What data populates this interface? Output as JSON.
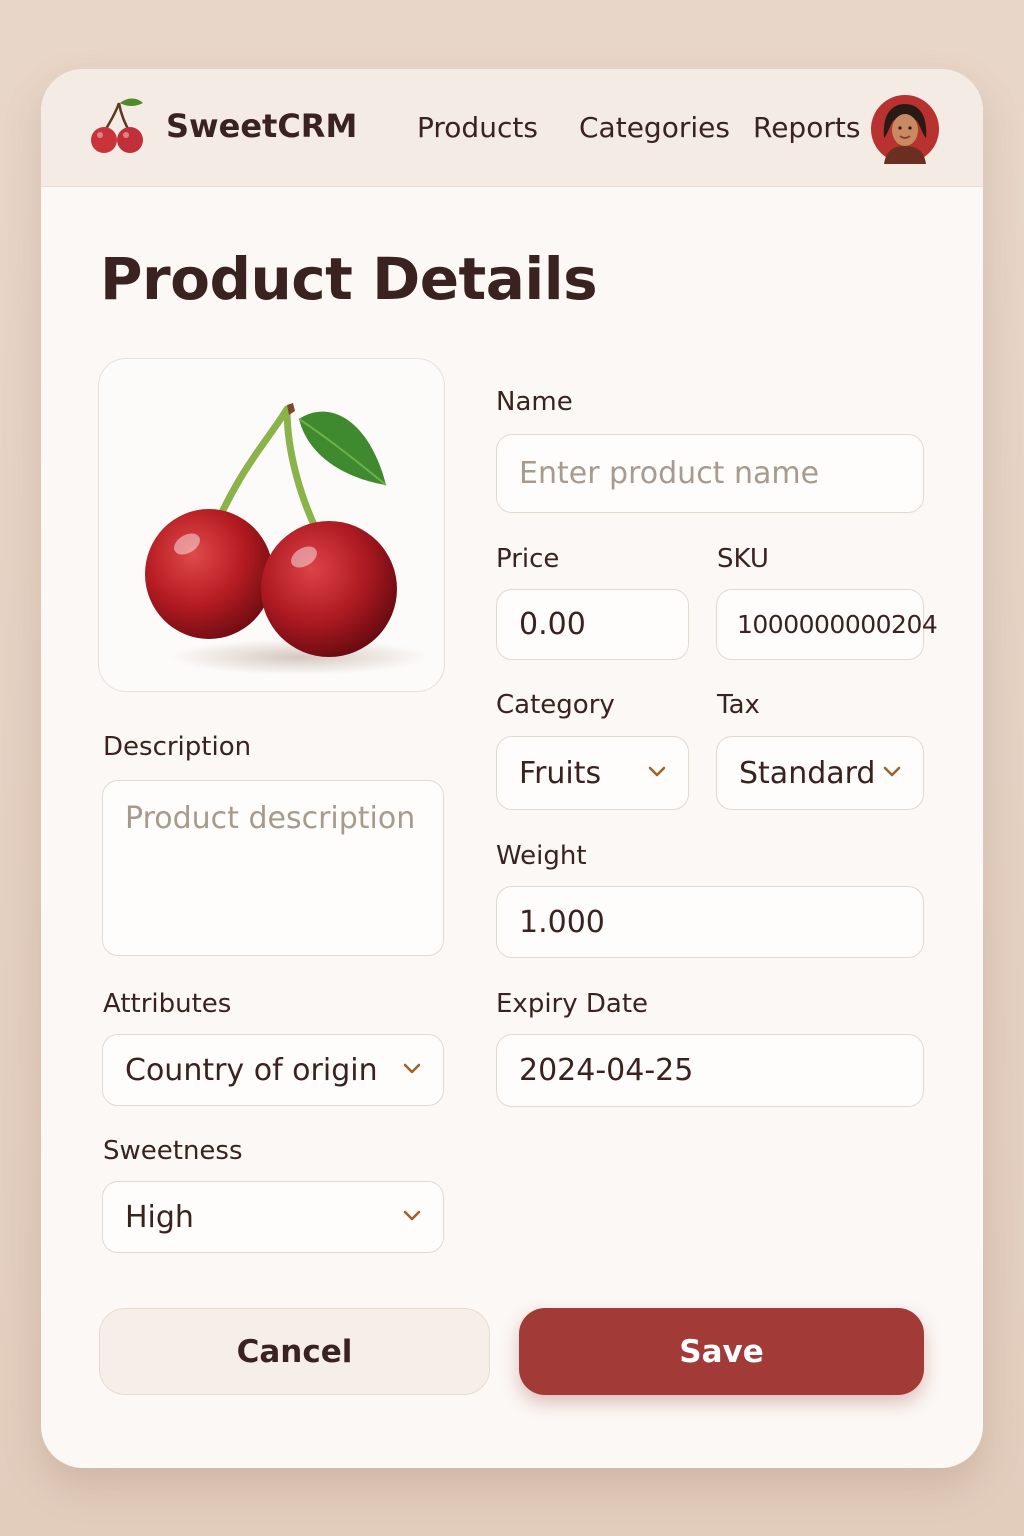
{
  "header": {
    "brand": "SweetCRM",
    "nav": [
      "Products",
      "Categories",
      "Reports"
    ]
  },
  "page": {
    "title": "Product Details"
  },
  "form": {
    "name": {
      "label": "Name",
      "placeholder": "Enter product name",
      "value": ""
    },
    "price": {
      "label": "Price",
      "value": "0.00"
    },
    "sku": {
      "label": "SKU",
      "value": "1000000000204"
    },
    "category": {
      "label": "Category",
      "value": "Fruits"
    },
    "tax": {
      "label": "Tax",
      "value": "Standard"
    },
    "weight": {
      "label": "Weight",
      "value": "1.000"
    },
    "description": {
      "label": "Description",
      "placeholder": "Product description",
      "value": ""
    },
    "attributes": {
      "label": "Attributes",
      "value": "Country of origin"
    },
    "expiry": {
      "label": "Expiry Date",
      "value": "2024-04-25"
    },
    "sweetness": {
      "label": "Sweetness",
      "value": "High"
    }
  },
  "actions": {
    "cancel": "Cancel",
    "save": "Save"
  },
  "colors": {
    "accent": "#a23a37",
    "background": "#e8d6c8",
    "card": "#fbf8f5",
    "text": "#3a2220",
    "chevron": "#a0602a"
  },
  "icons": {
    "logo": "cherry-icon",
    "dropdown": "chevron-down-icon",
    "avatar": "user-avatar"
  }
}
